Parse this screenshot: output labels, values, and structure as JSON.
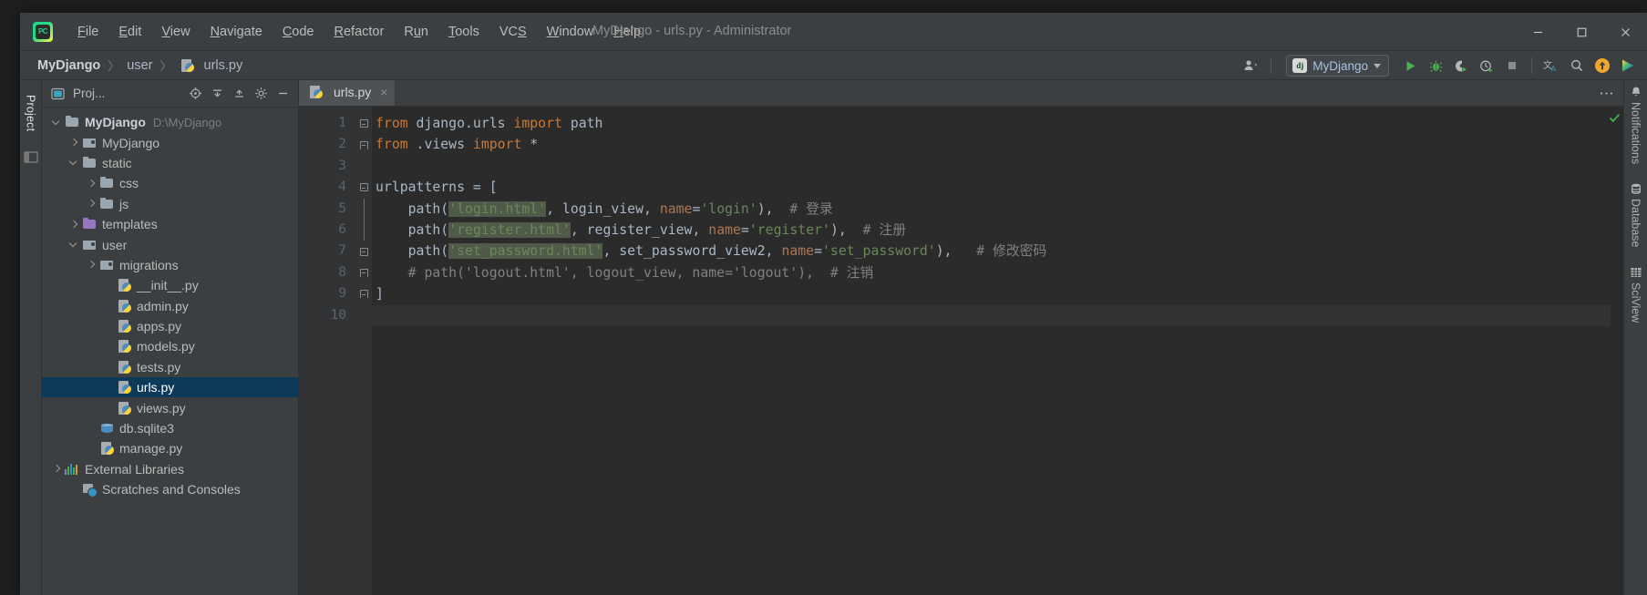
{
  "window": {
    "title": "MyDjango - urls.py - Administrator",
    "app_icon": "pycharm-logo-icon",
    "controls": {
      "minimize": "−",
      "maximize": "□",
      "close": "✕"
    }
  },
  "menu": {
    "items": [
      {
        "label": "File",
        "mnemonic": "F"
      },
      {
        "label": "Edit",
        "mnemonic": "E"
      },
      {
        "label": "View",
        "mnemonic": "V"
      },
      {
        "label": "Navigate",
        "mnemonic": "N"
      },
      {
        "label": "Code",
        "mnemonic": "C"
      },
      {
        "label": "Refactor",
        "mnemonic": "R"
      },
      {
        "label": "Run",
        "mnemonic": "u"
      },
      {
        "label": "Tools",
        "mnemonic": "T"
      },
      {
        "label": "VCS",
        "mnemonic": "S"
      },
      {
        "label": "Window",
        "mnemonic": "W"
      },
      {
        "label": "Help",
        "mnemonic": "H"
      }
    ]
  },
  "breadcrumb": {
    "items": [
      "MyDjango",
      "user",
      "urls.py"
    ],
    "separator": "〉",
    "file_icon": "python-file-icon"
  },
  "toolbar": {
    "user_icon": "user-account-icon",
    "run_config": {
      "label": "MyDjango",
      "badge": "dj",
      "icon": "django-icon"
    },
    "run_icon": "run-play-icon",
    "debug_icon": "debug-bug-icon",
    "coverage_icon": "run-with-coverage-icon",
    "profile_icon": "profiler-icon",
    "stop_icon": "stop-icon",
    "translate_icon": "translate-icon",
    "search_icon": "search-everywhere-icon",
    "update_icon": "update-project-icon",
    "ide_icon": "ide-feature-icon"
  },
  "left_strip": {
    "project_tab": "Project",
    "structure_icon": "structure-icon"
  },
  "project_panel": {
    "title": "Proj...",
    "icons": [
      "locate-icon",
      "collapse-all-icon",
      "expand-all-icon",
      "settings-gear-icon",
      "hide-icon"
    ],
    "tree": [
      {
        "label": "MyDjango",
        "sub": "D:\\MyDjango",
        "icon": "folder-icon",
        "arrow": "down",
        "indent": 0,
        "bold": true
      },
      {
        "label": "MyDjango",
        "sub": "",
        "icon": "module-folder-icon",
        "arrow": "right",
        "indent": 1,
        "bold": false
      },
      {
        "label": "static",
        "sub": "",
        "icon": "folder-icon",
        "arrow": "down",
        "indent": 1,
        "bold": false
      },
      {
        "label": "css",
        "sub": "",
        "icon": "folder-icon",
        "arrow": "right",
        "indent": 2,
        "bold": false
      },
      {
        "label": "js",
        "sub": "",
        "icon": "folder-icon",
        "arrow": "right",
        "indent": 2,
        "bold": false
      },
      {
        "label": "templates",
        "sub": "",
        "icon": "folder-purple-icon",
        "arrow": "right",
        "indent": 1,
        "bold": false
      },
      {
        "label": "user",
        "sub": "",
        "icon": "module-folder-icon",
        "arrow": "down",
        "indent": 1,
        "bold": false
      },
      {
        "label": "migrations",
        "sub": "",
        "icon": "module-folder-icon",
        "arrow": "right",
        "indent": 2,
        "bold": false
      },
      {
        "label": "__init__.py",
        "sub": "",
        "icon": "python-file-icon",
        "arrow": "none",
        "indent": 3,
        "bold": false
      },
      {
        "label": "admin.py",
        "sub": "",
        "icon": "python-file-icon",
        "arrow": "none",
        "indent": 3,
        "bold": false
      },
      {
        "label": "apps.py",
        "sub": "",
        "icon": "python-file-icon",
        "arrow": "none",
        "indent": 3,
        "bold": false
      },
      {
        "label": "models.py",
        "sub": "",
        "icon": "python-file-icon",
        "arrow": "none",
        "indent": 3,
        "bold": false
      },
      {
        "label": "tests.py",
        "sub": "",
        "icon": "python-file-icon",
        "arrow": "none",
        "indent": 3,
        "bold": false
      },
      {
        "label": "urls.py",
        "sub": "",
        "icon": "python-file-icon",
        "arrow": "none",
        "indent": 3,
        "bold": false,
        "selected": true
      },
      {
        "label": "views.py",
        "sub": "",
        "icon": "python-file-icon",
        "arrow": "none",
        "indent": 3,
        "bold": false
      },
      {
        "label": "db.sqlite3",
        "sub": "",
        "icon": "database-file-icon",
        "arrow": "none",
        "indent": 2,
        "bold": false
      },
      {
        "label": "manage.py",
        "sub": "",
        "icon": "python-file-icon",
        "arrow": "none",
        "indent": 2,
        "bold": false
      },
      {
        "label": "External Libraries",
        "sub": "",
        "icon": "libraries-icon",
        "arrow": "right",
        "indent": 0,
        "bold": false
      },
      {
        "label": "Scratches and Consoles",
        "sub": "",
        "icon": "scratches-icon",
        "arrow": "none",
        "indent": 1,
        "bold": false
      }
    ]
  },
  "editor": {
    "tabs": [
      {
        "label": "urls.py",
        "icon": "python-file-icon",
        "close": "×",
        "active": true
      }
    ],
    "options_icon": "editor-options-icon",
    "inspection_status": "ok-checkmark",
    "line_numbers": [
      "1",
      "2",
      "3",
      "4",
      "5",
      "6",
      "7",
      "8",
      "9",
      "10"
    ],
    "lines": [
      {
        "n": 1,
        "fold": "start",
        "tokens": [
          {
            "t": "from",
            "c": "kw"
          },
          {
            "t": " django.urls ",
            "c": "plain"
          },
          {
            "t": "import",
            "c": "kw"
          },
          {
            "t": " path",
            "c": "plain"
          }
        ]
      },
      {
        "n": 2,
        "fold": "end",
        "tokens": [
          {
            "t": "from",
            "c": "kw"
          },
          {
            "t": " .views ",
            "c": "plain"
          },
          {
            "t": "import",
            "c": "kw"
          },
          {
            "t": " *",
            "c": "plain"
          }
        ]
      },
      {
        "n": 3,
        "fold": "none",
        "tokens": []
      },
      {
        "n": 4,
        "fold": "start",
        "tokens": [
          {
            "t": "urlpatterns = [",
            "c": "plain"
          }
        ]
      },
      {
        "n": 5,
        "fold": "line",
        "tokens": [
          {
            "t": "    path(",
            "c": "plain"
          },
          {
            "t": "'login.html'",
            "c": "str hl"
          },
          {
            "t": ", login_view, ",
            "c": "plain"
          },
          {
            "t": "name",
            "c": "narg"
          },
          {
            "t": "=",
            "c": "plain"
          },
          {
            "t": "'login'",
            "c": "str"
          },
          {
            "t": "),  ",
            "c": "plain"
          },
          {
            "t": "# 登录",
            "c": "cmt"
          }
        ]
      },
      {
        "n": 6,
        "fold": "line",
        "tokens": [
          {
            "t": "    path(",
            "c": "plain"
          },
          {
            "t": "'register.html'",
            "c": "str hl"
          },
          {
            "t": ", register_view, ",
            "c": "plain"
          },
          {
            "t": "name",
            "c": "narg"
          },
          {
            "t": "=",
            "c": "plain"
          },
          {
            "t": "'register'",
            "c": "str"
          },
          {
            "t": "),  ",
            "c": "plain"
          },
          {
            "t": "# 注册",
            "c": "cmt"
          }
        ]
      },
      {
        "n": 7,
        "fold": "start",
        "tokens": [
          {
            "t": "    path(",
            "c": "plain"
          },
          {
            "t": "'set_password.html'",
            "c": "str hl"
          },
          {
            "t": ", set_password_view2, ",
            "c": "plain"
          },
          {
            "t": "name",
            "c": "narg"
          },
          {
            "t": "=",
            "c": "plain"
          },
          {
            "t": "'set_password'",
            "c": "str"
          },
          {
            "t": "),   ",
            "c": "plain"
          },
          {
            "t": "# 修改密码",
            "c": "cmt"
          }
        ]
      },
      {
        "n": 8,
        "fold": "end",
        "tokens": [
          {
            "t": "    # path('logout.html', logout_view, name='logout'),  # 注销",
            "c": "cmt"
          }
        ]
      },
      {
        "n": 9,
        "fold": "end",
        "tokens": [
          {
            "t": "]",
            "c": "plain"
          }
        ]
      },
      {
        "n": 10,
        "fold": "none",
        "current": true,
        "tokens": []
      }
    ]
  },
  "right_strip": {
    "items": [
      {
        "label": "Notifications",
        "icon": "bell-icon"
      },
      {
        "label": "Database",
        "icon": "database-icon"
      },
      {
        "label": "SciView",
        "icon": "grid-icon"
      }
    ]
  },
  "colors": {
    "bg_chrome": "#3c3f41",
    "bg_editor": "#2b2b2b",
    "gutter": "#313335",
    "selection": "#0d3a58",
    "keyword": "#cc7832",
    "string": "#6a8759",
    "comment": "#808080",
    "named_arg": "#aa7755",
    "text": "#a9b7c6",
    "accent_green": "#43b14b"
  }
}
